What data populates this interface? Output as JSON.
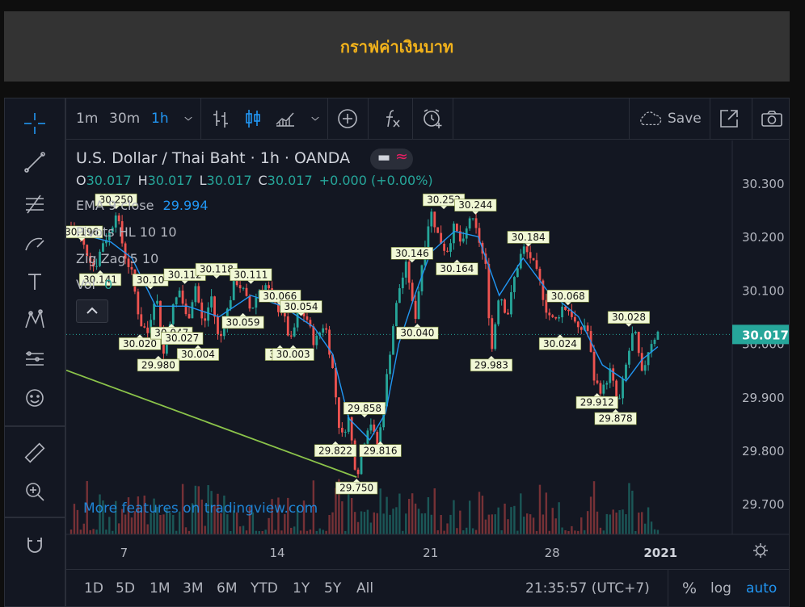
{
  "banner": {
    "title": "กราฟค่าเงินบาท"
  },
  "topbar": {
    "intervals": [
      "1m",
      "30m",
      "1h"
    ],
    "active_interval": "1h",
    "save_label": "Save"
  },
  "legend": {
    "symbol": "U.S. Dollar / Thai Baht · 1h · OANDA",
    "ohlc": [
      {
        "k": "O",
        "v": "30.017"
      },
      {
        "k": "H",
        "v": "30.017"
      },
      {
        "k": "L",
        "v": "30.017"
      },
      {
        "k": "C",
        "v": "30.017"
      }
    ],
    "change": "+0.000 (+0.00%)",
    "ema_label": "EMA 9 close",
    "ema_value": "29.994",
    "pivots_label": "Pivots HL 10 10",
    "zigzag_label": "Zig Zag 5 10",
    "vol_label": "Vol",
    "vol_value": "0"
  },
  "watermark": "More features on tradingview.com",
  "bottombar": {
    "ranges": [
      "1D",
      "5D",
      "1M",
      "3M",
      "6M",
      "YTD",
      "1Y",
      "5Y",
      "All"
    ],
    "time": "21:35:57 (UTC+7)",
    "pct": "%",
    "log": "log",
    "auto": "auto"
  },
  "colors": {
    "up": "#26a69a",
    "down": "#ef5350",
    "ema": "#2196f3",
    "trendline": "#8bc34a",
    "pivot_label_bg": "#f1f8d6",
    "price_tag": "#26a69a",
    "banner_text": "#f2b21b"
  },
  "chart_data": {
    "type": "candlestick",
    "symbol": "USDTHB",
    "interval": "1h",
    "y_ticks": [
      "30.300",
      "30.200",
      "30.100",
      "30.000",
      "29.900",
      "29.800",
      "29.700"
    ],
    "ylim": [
      29.67,
      30.35
    ],
    "x_ticks": [
      "7",
      "14",
      "21",
      "28",
      "2021"
    ],
    "last_price": "30.017",
    "price_path": [
      {
        "x": 0.0,
        "y": 30.22
      },
      {
        "x": 0.3,
        "y": 30.2
      },
      {
        "x": 0.6,
        "y": 30.17
      },
      {
        "x": 0.9,
        "y": 30.14
      },
      {
        "x": 1.2,
        "y": 30.19
      },
      {
        "x": 1.5,
        "y": 30.21
      },
      {
        "x": 1.7,
        "y": 30.25
      },
      {
        "x": 2.0,
        "y": 30.17
      },
      {
        "x": 2.3,
        "y": 30.13
      },
      {
        "x": 2.6,
        "y": 30.04
      },
      {
        "x": 2.9,
        "y": 30.02
      },
      {
        "x": 3.2,
        "y": 30.1
      },
      {
        "x": 3.5,
        "y": 29.98
      },
      {
        "x": 3.8,
        "y": 30.06
      },
      {
        "x": 4.1,
        "y": 30.1
      },
      {
        "x": 4.4,
        "y": 30.04
      },
      {
        "x": 4.7,
        "y": 30.11
      },
      {
        "x": 5.0,
        "y": 30.03
      },
      {
        "x": 5.3,
        "y": 30.09
      },
      {
        "x": 5.6,
        "y": 30.0
      },
      {
        "x": 5.9,
        "y": 30.06
      },
      {
        "x": 6.2,
        "y": 30.12
      },
      {
        "x": 6.5,
        "y": 30.1
      },
      {
        "x": 6.8,
        "y": 30.06
      },
      {
        "x": 7.1,
        "y": 30.1
      },
      {
        "x": 7.4,
        "y": 30.11
      },
      {
        "x": 7.7,
        "y": 30.07
      },
      {
        "x": 8.0,
        "y": 30.06
      },
      {
        "x": 8.3,
        "y": 30.0
      },
      {
        "x": 8.6,
        "y": 30.06
      },
      {
        "x": 8.9,
        "y": 30.05
      },
      {
        "x": 9.2,
        "y": 30.0
      },
      {
        "x": 9.6,
        "y": 30.04
      },
      {
        "x": 9.9,
        "y": 29.95
      },
      {
        "x": 10.2,
        "y": 29.82
      },
      {
        "x": 10.5,
        "y": 29.86
      },
      {
        "x": 10.8,
        "y": 29.75
      },
      {
        "x": 11.1,
        "y": 29.82
      },
      {
        "x": 11.3,
        "y": 29.86
      },
      {
        "x": 11.6,
        "y": 29.8
      },
      {
        "x": 11.9,
        "y": 29.92
      },
      {
        "x": 12.2,
        "y": 30.04
      },
      {
        "x": 12.4,
        "y": 30.1
      },
      {
        "x": 12.7,
        "y": 30.15
      },
      {
        "x": 13.0,
        "y": 30.04
      },
      {
        "x": 13.3,
        "y": 30.16
      },
      {
        "x": 13.6,
        "y": 30.25
      },
      {
        "x": 13.9,
        "y": 30.2
      },
      {
        "x": 14.2,
        "y": 30.17
      },
      {
        "x": 14.5,
        "y": 30.22
      },
      {
        "x": 14.8,
        "y": 30.18
      },
      {
        "x": 15.1,
        "y": 30.24
      },
      {
        "x": 15.4,
        "y": 30.2
      },
      {
        "x": 15.7,
        "y": 30.14
      },
      {
        "x": 15.9,
        "y": 29.98
      },
      {
        "x": 16.2,
        "y": 30.1
      },
      {
        "x": 16.5,
        "y": 30.05
      },
      {
        "x": 16.8,
        "y": 30.13
      },
      {
        "x": 17.1,
        "y": 30.18
      },
      {
        "x": 17.4,
        "y": 30.16
      },
      {
        "x": 17.7,
        "y": 30.12
      },
      {
        "x": 18.0,
        "y": 30.06
      },
      {
        "x": 18.3,
        "y": 30.04
      },
      {
        "x": 18.6,
        "y": 30.07
      },
      {
        "x": 18.9,
        "y": 30.06
      },
      {
        "x": 19.2,
        "y": 30.02
      },
      {
        "x": 19.5,
        "y": 30.04
      },
      {
        "x": 19.8,
        "y": 29.93
      },
      {
        "x": 20.1,
        "y": 29.91
      },
      {
        "x": 20.4,
        "y": 29.95
      },
      {
        "x": 20.7,
        "y": 29.88
      },
      {
        "x": 21.0,
        "y": 29.96
      },
      {
        "x": 21.3,
        "y": 30.03
      },
      {
        "x": 21.6,
        "y": 29.94
      },
      {
        "x": 21.9,
        "y": 30.0
      },
      {
        "x": 22.2,
        "y": 30.02
      }
    ],
    "ema_series": [
      {
        "x": 0.0,
        "y": 30.21
      },
      {
        "x": 1.5,
        "y": 30.19
      },
      {
        "x": 2.3,
        "y": 30.16
      },
      {
        "x": 3.2,
        "y": 30.07
      },
      {
        "x": 4.4,
        "y": 30.07
      },
      {
        "x": 5.6,
        "y": 30.05
      },
      {
        "x": 6.8,
        "y": 30.09
      },
      {
        "x": 8.0,
        "y": 30.07
      },
      {
        "x": 9.2,
        "y": 30.03
      },
      {
        "x": 9.9,
        "y": 29.98
      },
      {
        "x": 10.5,
        "y": 29.86
      },
      {
        "x": 11.3,
        "y": 29.82
      },
      {
        "x": 11.9,
        "y": 29.87
      },
      {
        "x": 12.4,
        "y": 30.0
      },
      {
        "x": 13.0,
        "y": 30.09
      },
      {
        "x": 13.6,
        "y": 30.17
      },
      {
        "x": 14.5,
        "y": 30.21
      },
      {
        "x": 15.4,
        "y": 30.2
      },
      {
        "x": 16.2,
        "y": 30.09
      },
      {
        "x": 17.1,
        "y": 30.16
      },
      {
        "x": 18.0,
        "y": 30.1
      },
      {
        "x": 19.2,
        "y": 30.05
      },
      {
        "x": 20.1,
        "y": 29.96
      },
      {
        "x": 21.0,
        "y": 29.93
      },
      {
        "x": 21.6,
        "y": 29.97
      },
      {
        "x": 22.2,
        "y": 29.994
      }
    ],
    "trendline": [
      {
        "x": 0.0,
        "y": 29.95
      },
      {
        "x": 10.8,
        "y": 29.75
      }
    ],
    "pivot_labels": [
      {
        "text": "30.250",
        "x": 1.7,
        "y": 30.25,
        "pos": "above"
      },
      {
        "text": "30.196",
        "x": 0.4,
        "y": 30.19,
        "pos": "above"
      },
      {
        "text": "30.141",
        "x": 1.1,
        "y": 30.14,
        "pos": "below"
      },
      {
        "text": "30.10",
        "x": 3.0,
        "y": 30.1,
        "pos": "above"
      },
      {
        "text": "30.112",
        "x": 4.3,
        "y": 30.11,
        "pos": "above"
      },
      {
        "text": "30.118",
        "x": 5.5,
        "y": 30.12,
        "pos": "above"
      },
      {
        "text": "30.111",
        "x": 6.8,
        "y": 30.11,
        "pos": "above"
      },
      {
        "text": "30.066",
        "x": 7.9,
        "y": 30.07,
        "pos": "above"
      },
      {
        "text": "30.054",
        "x": 8.7,
        "y": 30.05,
        "pos": "above"
      },
      {
        "text": "30.020",
        "x": 2.6,
        "y": 30.02,
        "pos": "below"
      },
      {
        "text": "30.047",
        "x": 3.8,
        "y": 30.04,
        "pos": "below"
      },
      {
        "text": "30.027",
        "x": 4.2,
        "y": 30.03,
        "pos": "below"
      },
      {
        "text": "30.004",
        "x": 4.8,
        "y": 30.0,
        "pos": "below"
      },
      {
        "text": "29.980",
        "x": 3.3,
        "y": 29.98,
        "pos": "below"
      },
      {
        "text": "30.059",
        "x": 6.5,
        "y": 30.06,
        "pos": "below"
      },
      {
        "text": "30.0",
        "x": 7.9,
        "y": 30.0,
        "pos": "below"
      },
      {
        "text": "30.003",
        "x": 8.4,
        "y": 30.0,
        "pos": "below"
      },
      {
        "text": "29.858",
        "x": 11.1,
        "y": 29.86,
        "pos": "above"
      },
      {
        "text": "29.822",
        "x": 10.0,
        "y": 29.82,
        "pos": "below"
      },
      {
        "text": "29.816",
        "x": 11.7,
        "y": 29.82,
        "pos": "below"
      },
      {
        "text": "29.750",
        "x": 10.8,
        "y": 29.75,
        "pos": "below"
      },
      {
        "text": "30.146",
        "x": 12.9,
        "y": 30.15,
        "pos": "above"
      },
      {
        "text": "30.040",
        "x": 13.1,
        "y": 30.04,
        "pos": "below"
      },
      {
        "text": "30.252",
        "x": 14.1,
        "y": 30.25,
        "pos": "above"
      },
      {
        "text": "30.244",
        "x": 15.3,
        "y": 30.24,
        "pos": "above"
      },
      {
        "text": "30.164",
        "x": 14.6,
        "y": 30.16,
        "pos": "below"
      },
      {
        "text": "30.184",
        "x": 17.3,
        "y": 30.18,
        "pos": "above"
      },
      {
        "text": "29.983",
        "x": 15.9,
        "y": 29.98,
        "pos": "below"
      },
      {
        "text": "30.068",
        "x": 18.8,
        "y": 30.07,
        "pos": "above"
      },
      {
        "text": "30.024",
        "x": 18.5,
        "y": 30.02,
        "pos": "below"
      },
      {
        "text": "30.028",
        "x": 21.1,
        "y": 30.03,
        "pos": "above"
      },
      {
        "text": "29.912",
        "x": 19.9,
        "y": 29.91,
        "pos": "below"
      },
      {
        "text": "29.878",
        "x": 20.6,
        "y": 29.88,
        "pos": "below"
      }
    ]
  }
}
